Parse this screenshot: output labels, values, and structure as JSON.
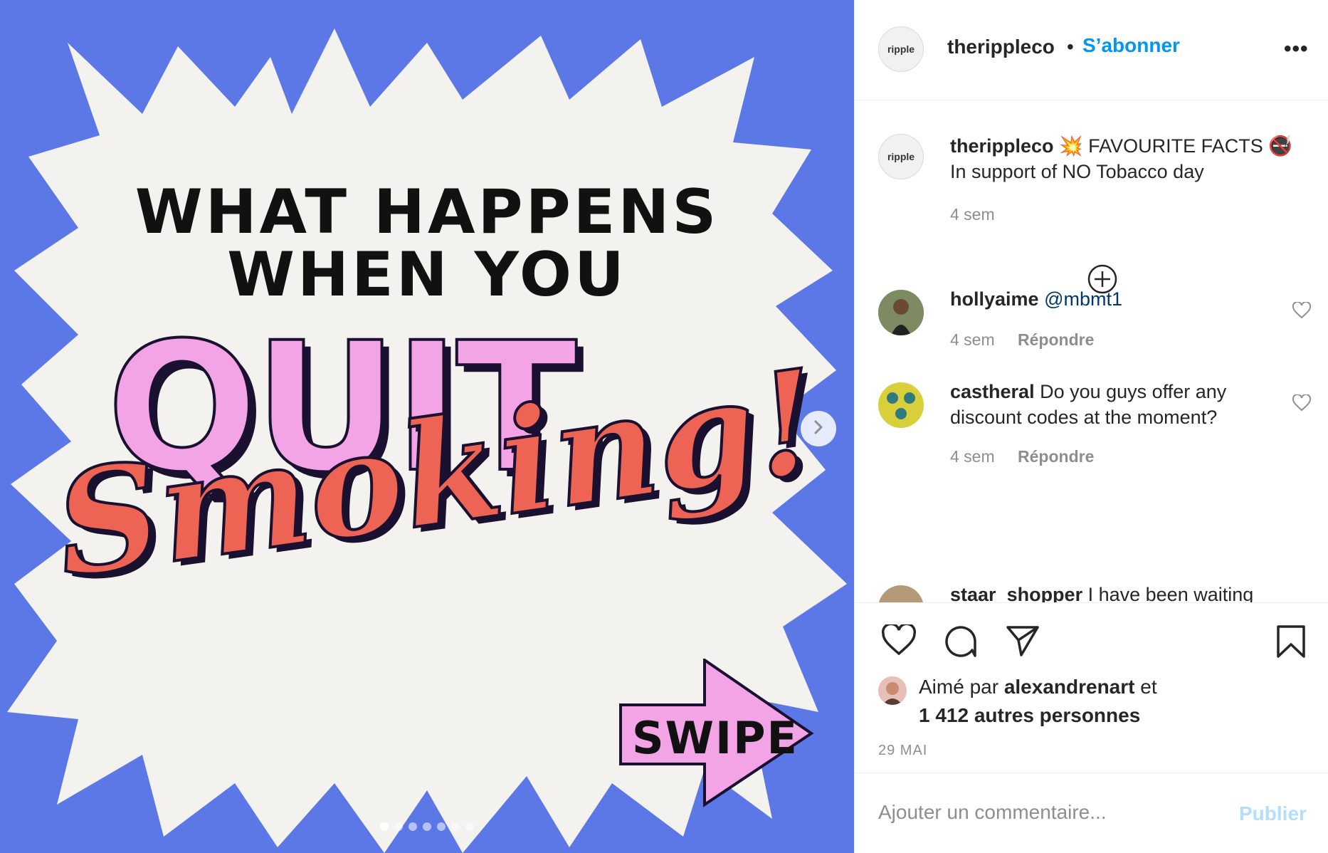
{
  "post": {
    "image": {
      "headline_line1": "WHAT HAPPENS",
      "headline_line2": "WHEN YOU",
      "headline_big": "QUIT",
      "headline_script": "Smoking!",
      "swipe_label": "SWIPE",
      "background_color": "#5b78e6",
      "carousel_count": 7,
      "carousel_active": 1
    },
    "author": {
      "avatar_text": "ripple",
      "username": "therippleco",
      "separator": "•",
      "follow_label": "S’abonner",
      "more_label": "•••"
    },
    "caption": {
      "username": "therippleco",
      "text": "💥 FAVOURITE FACTS 🚭 In support of NO Tobacco day",
      "time": "4 sem"
    },
    "comments": [
      {
        "username": "hollyaime",
        "mention": "@mbmt1",
        "text": "",
        "time": "4 sem",
        "reply_label": "Répondre"
      },
      {
        "username": "castheral",
        "mention": "",
        "text": "Do you guys offer any discount codes at the moment?",
        "time": "4 sem",
        "reply_label": "Répondre"
      },
      {
        "username": "staar_shopper",
        "mention": "",
        "text": "I have been waiting",
        "time": "",
        "reply_label": ""
      }
    ],
    "likes": {
      "prefix": "Aimé par",
      "user": "alexandrenart",
      "middle": "et",
      "others": "1 412 autres personnes"
    },
    "date": "29 MAI",
    "add_comment": {
      "placeholder": "Ajouter un commentaire...",
      "publish_label": "Publier"
    },
    "colors": {
      "link_blue": "#0095f6",
      "muted": "#8e8e8e",
      "publish_disabled": "#b2dffc"
    }
  }
}
